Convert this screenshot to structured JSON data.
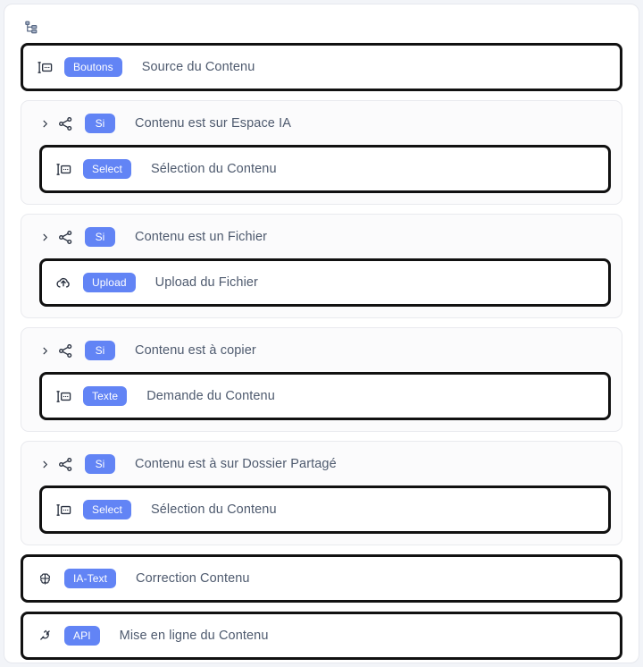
{
  "header": {
    "icon": "hierarchy-tree-icon"
  },
  "theme": {
    "badge_bg": "#6284F5",
    "badge_text": "#FFFFFF",
    "node_border": "#111111",
    "label_text": "#4E5A6E",
    "group_bg": "#FBFBFC",
    "group_border": "#E9EAEE",
    "canvas_bg": "#FFFFFF",
    "page_bg": "#F2F4F8"
  },
  "flow": [
    {
      "kind": "node",
      "icon": "form-input-icon",
      "badge": "Boutons",
      "label": "Source du Contenu"
    },
    {
      "kind": "group",
      "condition": {
        "chevron": "chevron-right-icon",
        "icon": "branch-icon",
        "badge": "Si",
        "label": "Contenu est sur Espace IA"
      },
      "node": {
        "icon": "form-input-icon",
        "badge": "Select",
        "label": "Sélection du Contenu"
      }
    },
    {
      "kind": "group",
      "condition": {
        "chevron": "chevron-right-icon",
        "icon": "branch-icon",
        "badge": "Si",
        "label": "Contenu est un Fichier"
      },
      "node": {
        "icon": "cloud-upload-icon",
        "badge": "Upload",
        "label": "Upload du Fichier"
      }
    },
    {
      "kind": "group",
      "condition": {
        "chevron": "chevron-right-icon",
        "icon": "branch-icon",
        "badge": "Si",
        "label": "Contenu est à copier"
      },
      "node": {
        "icon": "form-input-icon",
        "badge": "Texte",
        "label": "Demande du Contenu"
      }
    },
    {
      "kind": "group",
      "condition": {
        "chevron": "chevron-right-icon",
        "icon": "branch-icon",
        "badge": "Si",
        "label": "Contenu est à sur Dossier Partagé"
      },
      "node": {
        "icon": "form-input-icon",
        "badge": "Select",
        "label": "Sélection du Contenu"
      }
    },
    {
      "kind": "node",
      "icon": "brain-icon",
      "badge": "IA-Text",
      "label": "Correction Contenu"
    },
    {
      "kind": "node",
      "icon": "plug-icon",
      "badge": "API",
      "label": "Mise en ligne du Contenu"
    }
  ]
}
